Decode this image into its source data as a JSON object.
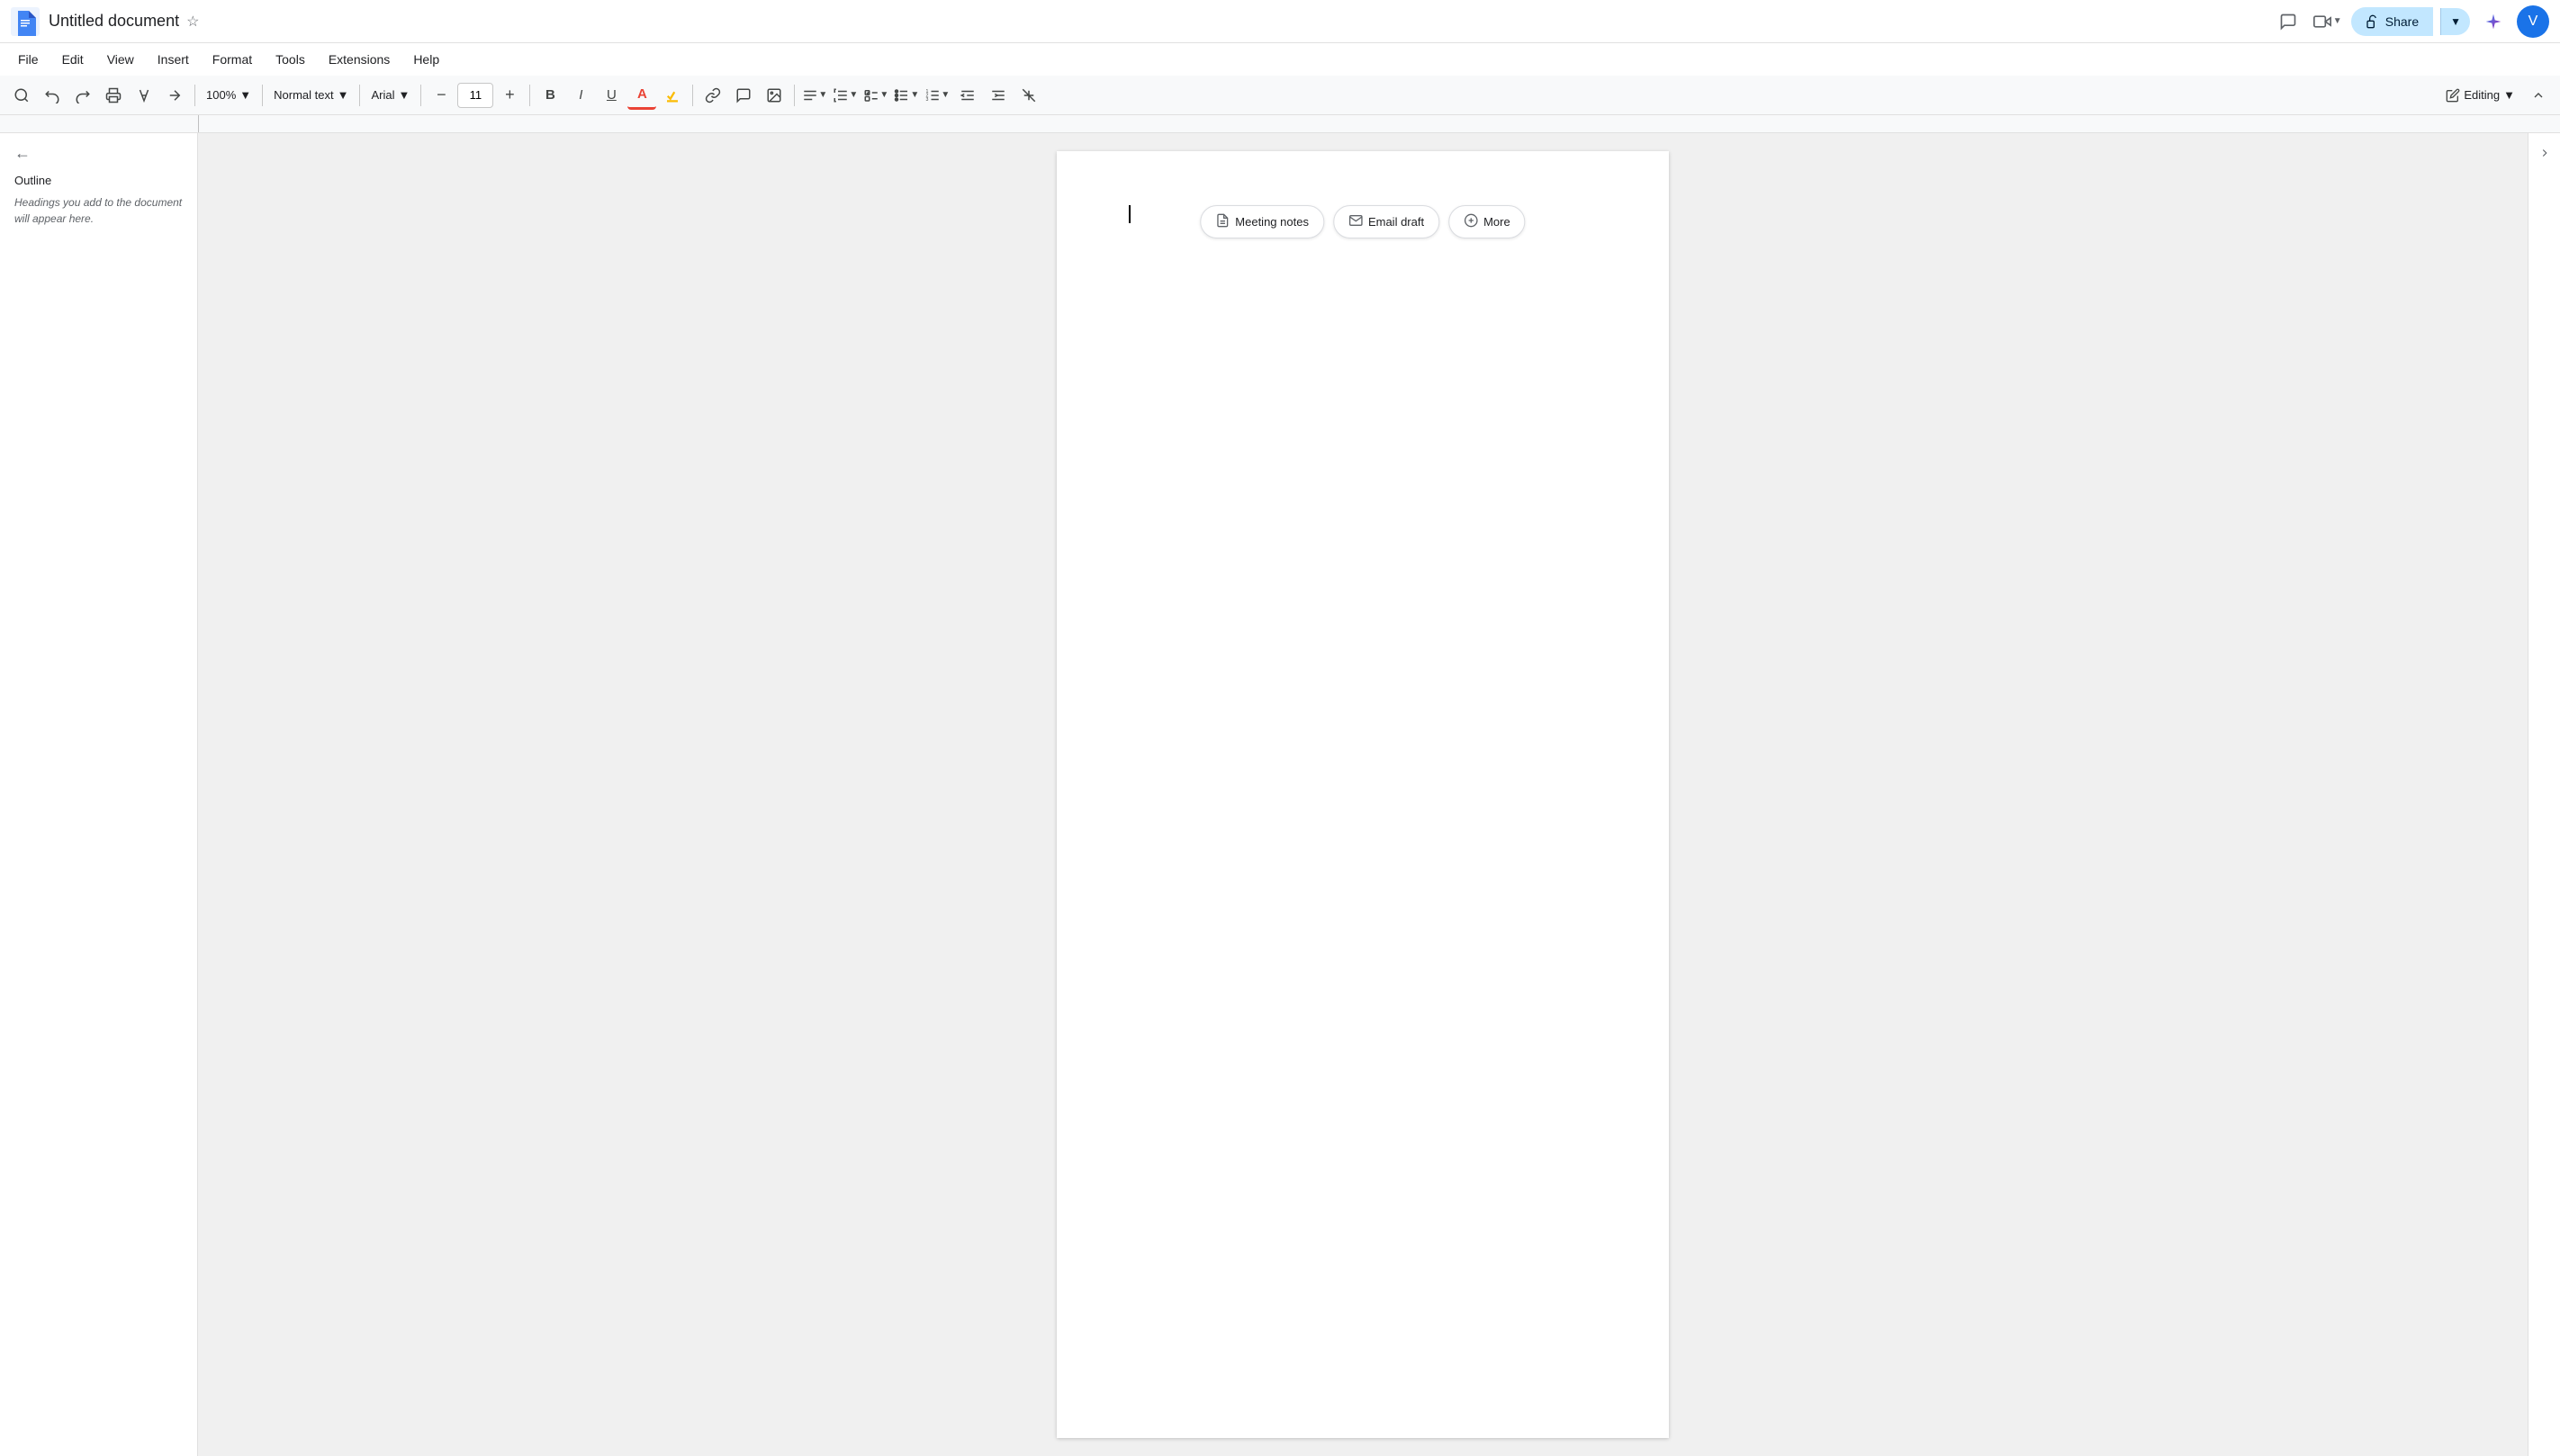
{
  "title_bar": {
    "doc_title": "Untitled document",
    "star_icon": "⭐",
    "share_label": "Share",
    "avatar_letter": "V"
  },
  "menu": {
    "items": [
      "File",
      "Edit",
      "View",
      "Insert",
      "Format",
      "Tools",
      "Extensions",
      "Help"
    ]
  },
  "toolbar": {
    "zoom": "100%",
    "style": "Normal text",
    "font": "Arial",
    "font_size": "11",
    "bold_label": "B",
    "italic_label": "I",
    "editing_label": "Editing"
  },
  "sidebar": {
    "outline_title": "Outline",
    "outline_hint": "Headings you add to the document will appear here."
  },
  "templates": {
    "chips": [
      {
        "id": "meeting-notes",
        "icon": "📄",
        "label": "Meeting notes"
      },
      {
        "id": "email-draft",
        "icon": "✉",
        "label": "Email draft"
      },
      {
        "id": "more",
        "icon": "⊕",
        "label": "More"
      }
    ]
  },
  "colors": {
    "accent": "#1a73e8",
    "share_bg": "#c2e7ff",
    "toolbar_bg": "#f8f9fa",
    "text_primary": "#202124",
    "text_secondary": "#5f6368"
  }
}
